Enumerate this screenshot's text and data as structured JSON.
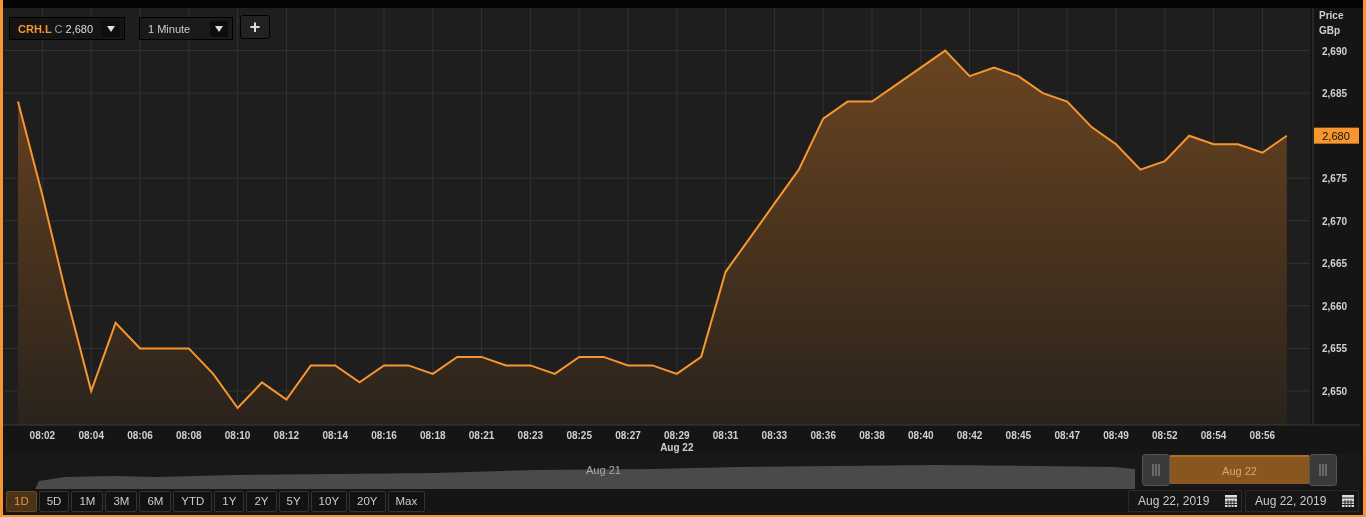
{
  "symbol_selector": {
    "price_prefix": "C",
    "price": "2,680"
  },
  "interval_selector": {
    "value": "1 Minute"
  },
  "add_button": {
    "label": "+"
  },
  "axis_title": [
    "Price",
    "GBp"
  ],
  "current_price_label": "2,680",
  "date_marker": "Aug 22",
  "chart": {
    "chart_data": {
      "type": "area",
      "grid": true,
      "categories": [
        null,
        "08:02",
        null,
        "08:04",
        null,
        "08:06",
        null,
        "08:08",
        null,
        "08:10",
        null,
        "08:12",
        null,
        "08:14",
        null,
        "08:16",
        null,
        "08:18",
        null,
        "08:21",
        null,
        "08:23",
        null,
        "08:25",
        null,
        "08:27",
        null,
        "08:29",
        null,
        "08:31",
        null,
        "08:33",
        null,
        "08:36",
        null,
        "08:38",
        null,
        "08:40",
        null,
        "08:42",
        null,
        "08:45",
        null,
        "08:47",
        null,
        "08:49",
        null,
        "08:52",
        null,
        "08:54",
        null,
        "08:56",
        null
      ],
      "series": [
        {
          "name": "CRH.L",
          "color": "#f7962f",
          "values": [
            2684,
            2673,
            2661,
            2650,
            2658,
            2655,
            2655,
            2655,
            2652,
            2648,
            2651,
            2649,
            2653,
            2653,
            2651,
            2653,
            2653,
            2652,
            2654,
            2654,
            2653,
            2653,
            2652,
            2654,
            2654,
            2653,
            2653,
            2652,
            2654,
            2664,
            2668,
            2672,
            2676,
            2682,
            2684,
            2684,
            2686,
            2688,
            2690,
            2687,
            2688,
            2687,
            2685,
            2684,
            2681,
            2679,
            2676,
            2677,
            2680,
            2679,
            2679,
            2678,
            2680
          ]
        }
      ],
      "ylim": [
        2646,
        2695
      ],
      "yticks": [
        {
          "value": 2650,
          "label": "2,650"
        },
        {
          "value": 2655,
          "label": "2,655"
        },
        {
          "value": 2660,
          "label": "2,660"
        },
        {
          "value": 2665,
          "label": "2,665"
        },
        {
          "value": 2670,
          "label": "2,670"
        },
        {
          "value": 2675,
          "label": "2,675"
        },
        {
          "value": 2685,
          "label": "2,685"
        },
        {
          "value": 2690,
          "label": "2,690"
        }
      ]
    }
  },
  "navigator": {
    "labels": [
      "Aug 21",
      "Aug 22"
    ]
  },
  "ranges": [
    {
      "label": "1D",
      "selected": true
    },
    {
      "label": "5D",
      "selected": false
    },
    {
      "label": "1M",
      "selected": false
    },
    {
      "label": "3M",
      "selected": false
    },
    {
      "label": "6M",
      "selected": false
    },
    {
      "label": "YTD",
      "selected": false
    },
    {
      "label": "1Y",
      "selected": false
    },
    {
      "label": "2Y",
      "selected": false
    },
    {
      "label": "5Y",
      "selected": false
    },
    {
      "label": "10Y",
      "selected": false
    },
    {
      "label": "20Y",
      "selected": false
    },
    {
      "label": "Max",
      "selected": false
    }
  ],
  "date_from": "Aug 22, 2019",
  "date_to": "Aug 22, 2019"
}
